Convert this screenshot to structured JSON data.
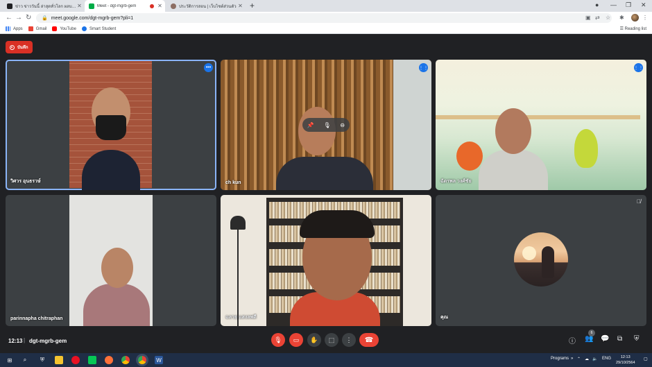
{
  "browser": {
    "tabs": [
      {
        "label": "ข่าว ข่าววันนี้ ล่าสุดทั่วโลก ผลบอลเมื่อ...",
        "fav_color": "#202124",
        "active": false
      },
      {
        "label": "Meet - dgt-mgrb-gem",
        "fav_color": "#00ac47",
        "active": true
      },
      {
        "label": "ประวัติการสอน | เว็บไซต์ส่วนตัว",
        "fav_color": "#8d6e63",
        "active": false
      }
    ],
    "url": "meet.google.com/dgt-mgrb-gem?pli=1",
    "bookmarks": [
      {
        "label": "Apps",
        "color": "#4285f4"
      },
      {
        "label": "Gmail",
        "color": "#ea4335"
      },
      {
        "label": "YouTube",
        "color": "#ff0000"
      },
      {
        "label": "Smart Student",
        "color": "#1a73e8"
      }
    ],
    "reading_list": "Reading list"
  },
  "meeting": {
    "record_label": "บันทึก",
    "participants": [
      {
        "name": "วิศวร อุนธรวษ์",
        "badge": "•••"
      },
      {
        "name": "ch kun",
        "badge": "⋮⋮"
      },
      {
        "name": "ฉัตรพล วงศ์ชัย",
        "badge": "⋮⋮"
      },
      {
        "name": "parinnapha chitraphan"
      },
      {
        "name": "ฉลวย แสงลพดี"
      },
      {
        "name": "คุณ"
      }
    ],
    "time": "12:13",
    "code": "dgt-mgrb-gem",
    "participant_count": "6"
  },
  "taskbar": {
    "programs_label": "Programs",
    "lang": "ENG",
    "clock_time": "12:13",
    "clock_date": "29/10/2564"
  }
}
